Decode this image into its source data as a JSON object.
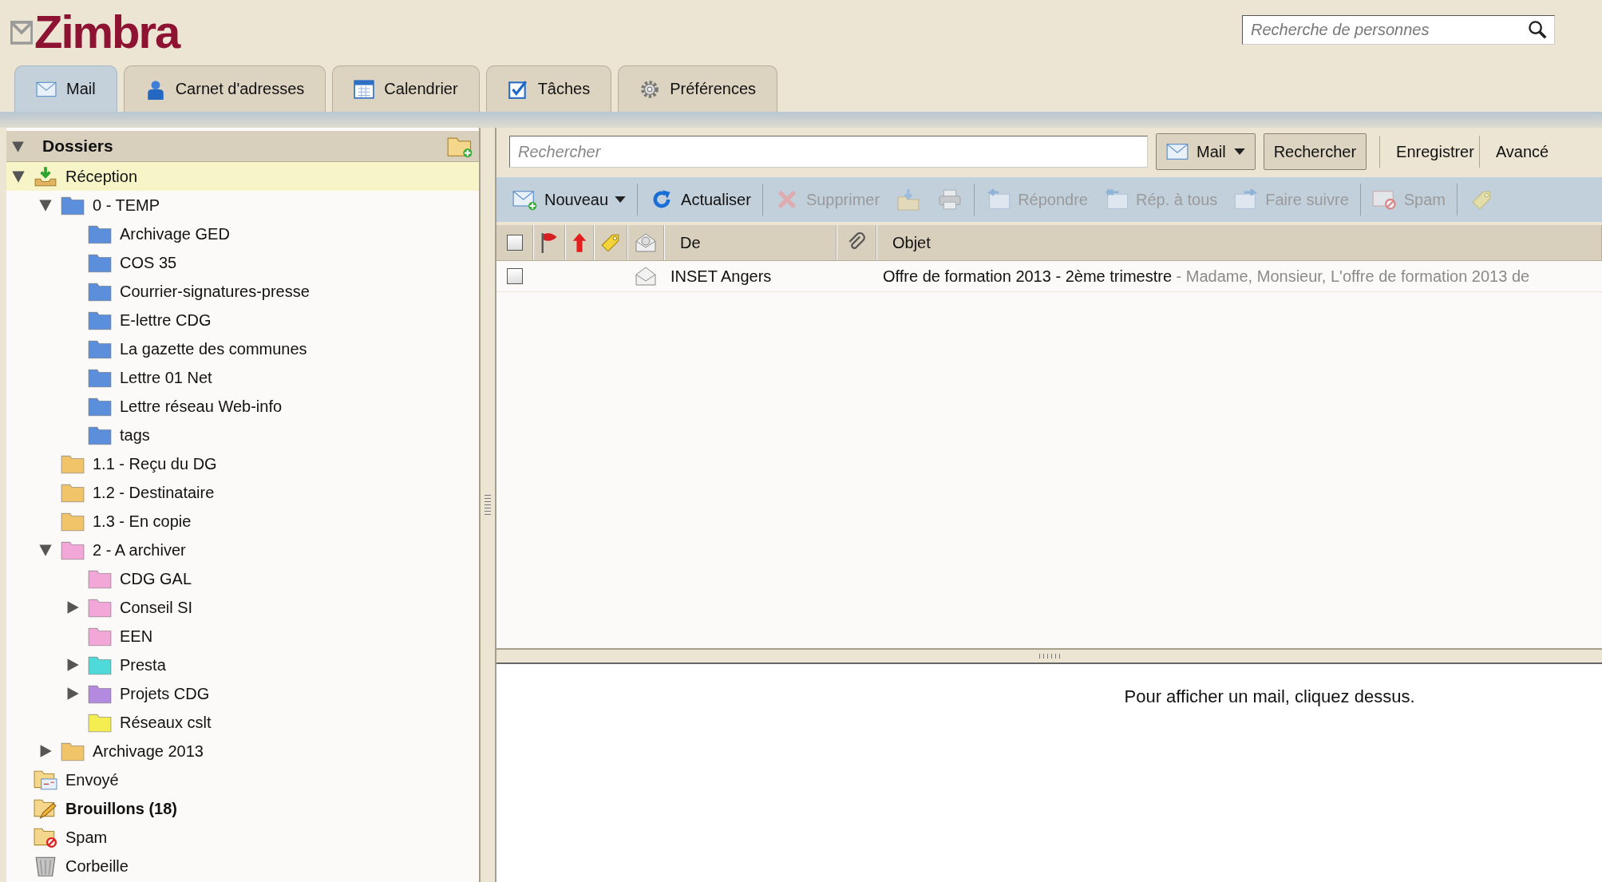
{
  "logo": "Zimbra",
  "people_search": {
    "placeholder": "Recherche de personnes"
  },
  "tabs": [
    {
      "label": "Mail",
      "kind": "mail",
      "selected": true
    },
    {
      "label": "Carnet d'adresses",
      "kind": "contacts",
      "selected": false
    },
    {
      "label": "Calendrier",
      "kind": "calendar",
      "selected": false
    },
    {
      "label": "Tâches",
      "kind": "tasks",
      "selected": false
    },
    {
      "label": "Préférences",
      "kind": "settings",
      "selected": false
    }
  ],
  "folders": {
    "title": "Dossiers",
    "expanded": true,
    "items": [
      {
        "label": "Réception",
        "kind": "inbox",
        "selected": true,
        "unread": false,
        "expanded": true,
        "children": [
          {
            "label": "0 - TEMP",
            "kind": "folder",
            "color": "#5b8fdc",
            "selected": false,
            "unread": false,
            "expanded": true,
            "children": [
              {
                "label": "Archivage GED",
                "kind": "folder",
                "color": "#5b8fdc",
                "selected": false,
                "unread": false
              },
              {
                "label": "COS 35",
                "kind": "folder",
                "color": "#5b8fdc",
                "selected": false,
                "unread": false
              },
              {
                "label": "Courrier-signatures-presse",
                "kind": "folder",
                "color": "#5b8fdc",
                "selected": false,
                "unread": false
              },
              {
                "label": "E-lettre CDG",
                "kind": "folder",
                "color": "#5b8fdc",
                "selected": false,
                "unread": false
              },
              {
                "label": "La gazette des communes",
                "kind": "folder",
                "color": "#5b8fdc",
                "selected": false,
                "unread": false
              },
              {
                "label": "Lettre 01 Net",
                "kind": "folder",
                "color": "#5b8fdc",
                "selected": false,
                "unread": false
              },
              {
                "label": "Lettre réseau Web-info",
                "kind": "folder",
                "color": "#5b8fdc",
                "selected": false,
                "unread": false
              },
              {
                "label": "tags",
                "kind": "folder",
                "color": "#5b8fdc",
                "selected": false,
                "unread": false
              }
            ]
          },
          {
            "label": "1.1 - Reçu du DG",
            "kind": "folder",
            "color": "#f2c46a",
            "selected": false,
            "unread": false
          },
          {
            "label": "1.2 - Destinataire",
            "kind": "folder",
            "color": "#f2c46a",
            "selected": false,
            "unread": false
          },
          {
            "label": "1.3 - En copie",
            "kind": "folder",
            "color": "#f2c46a",
            "selected": false,
            "unread": false
          },
          {
            "label": "2 - A archiver",
            "kind": "folder",
            "color": "#f3a6d8",
            "selected": false,
            "unread": false,
            "expanded": true,
            "children": [
              {
                "label": "CDG GAL",
                "kind": "folder",
                "color": "#f3a6d8",
                "selected": false,
                "unread": false
              },
              {
                "label": "Conseil SI",
                "kind": "folder",
                "color": "#f3a6d8",
                "selected": false,
                "unread": false,
                "expanded": false
              },
              {
                "label": "EEN",
                "kind": "folder",
                "color": "#f3a6d8",
                "selected": false,
                "unread": false
              },
              {
                "label": "Presta",
                "kind": "folder",
                "color": "#4fdada",
                "selected": false,
                "unread": false,
                "expanded": false
              },
              {
                "label": "Projets CDG",
                "kind": "folder",
                "color": "#b38ae0",
                "selected": false,
                "unread": false,
                "expanded": false
              },
              {
                "label": "Réseaux cslt",
                "kind": "folder",
                "color": "#f5ee50",
                "selected": false,
                "unread": false
              }
            ]
          },
          {
            "label": "Archivage 2013",
            "kind": "folder",
            "color": "#f2c46a",
            "selected": false,
            "unread": false,
            "expanded": false
          }
        ]
      },
      {
        "label": "Envoyé",
        "kind": "sent",
        "selected": false,
        "unread": false
      },
      {
        "label": "Brouillons (18)",
        "kind": "drafts",
        "selected": false,
        "unread": true
      },
      {
        "label": "Spam",
        "kind": "spam",
        "selected": false,
        "unread": false
      },
      {
        "label": "Corbeille",
        "kind": "trash",
        "selected": false,
        "unread": false
      }
    ]
  },
  "search": {
    "placeholder": "Rechercher",
    "type_button": "Mail",
    "search_button": "Rechercher",
    "links": [
      "Enregistrer",
      "Avancé"
    ]
  },
  "toolbar": [
    {
      "items": [
        {
          "kind": "compose",
          "label": "Nouveau",
          "disabled": false,
          "dropdown": true
        }
      ]
    },
    {
      "items": [
        {
          "kind": "refresh",
          "label": "Actualiser",
          "disabled": false,
          "dropdown": false
        }
      ]
    },
    {
      "items": [
        {
          "kind": "delete",
          "label": "Supprimer",
          "disabled": true,
          "dropdown": false
        },
        {
          "kind": "move",
          "disabled": true,
          "dropdown": false
        },
        {
          "kind": "print",
          "disabled": true,
          "dropdown": false
        }
      ]
    },
    {
      "items": [
        {
          "kind": "reply",
          "label": "Répondre",
          "disabled": true,
          "dropdown": false
        },
        {
          "kind": "reply-all",
          "label": "Rép. à tous",
          "disabled": true,
          "dropdown": false
        },
        {
          "kind": "forward",
          "label": "Faire suivre",
          "disabled": true,
          "dropdown": false
        }
      ]
    },
    {
      "items": [
        {
          "kind": "spam",
          "label": "Spam",
          "disabled": true,
          "dropdown": false
        }
      ]
    },
    {
      "items": [
        {
          "kind": "tag",
          "disabled": true,
          "dropdown": false
        }
      ]
    }
  ],
  "columns": [
    {
      "kind": "checkbox",
      "checked": false
    },
    {
      "kind": "flag"
    },
    {
      "kind": "priority"
    },
    {
      "kind": "tag"
    },
    {
      "kind": "status"
    },
    {
      "kind": "text",
      "label": "De"
    },
    {
      "kind": "attachment"
    },
    {
      "kind": "text",
      "label": "Objet"
    }
  ],
  "messages": [
    {
      "checked": false,
      "read": true,
      "from": "INSET Angers",
      "subject": "Offre de formation 2013 - 2ème trimestre",
      "fragment": "- Madame, Monsieur, L'offre de formation 2013 de"
    }
  ],
  "reading_pane": {
    "message": "Pour afficher un mail, cliquez dessus."
  }
}
